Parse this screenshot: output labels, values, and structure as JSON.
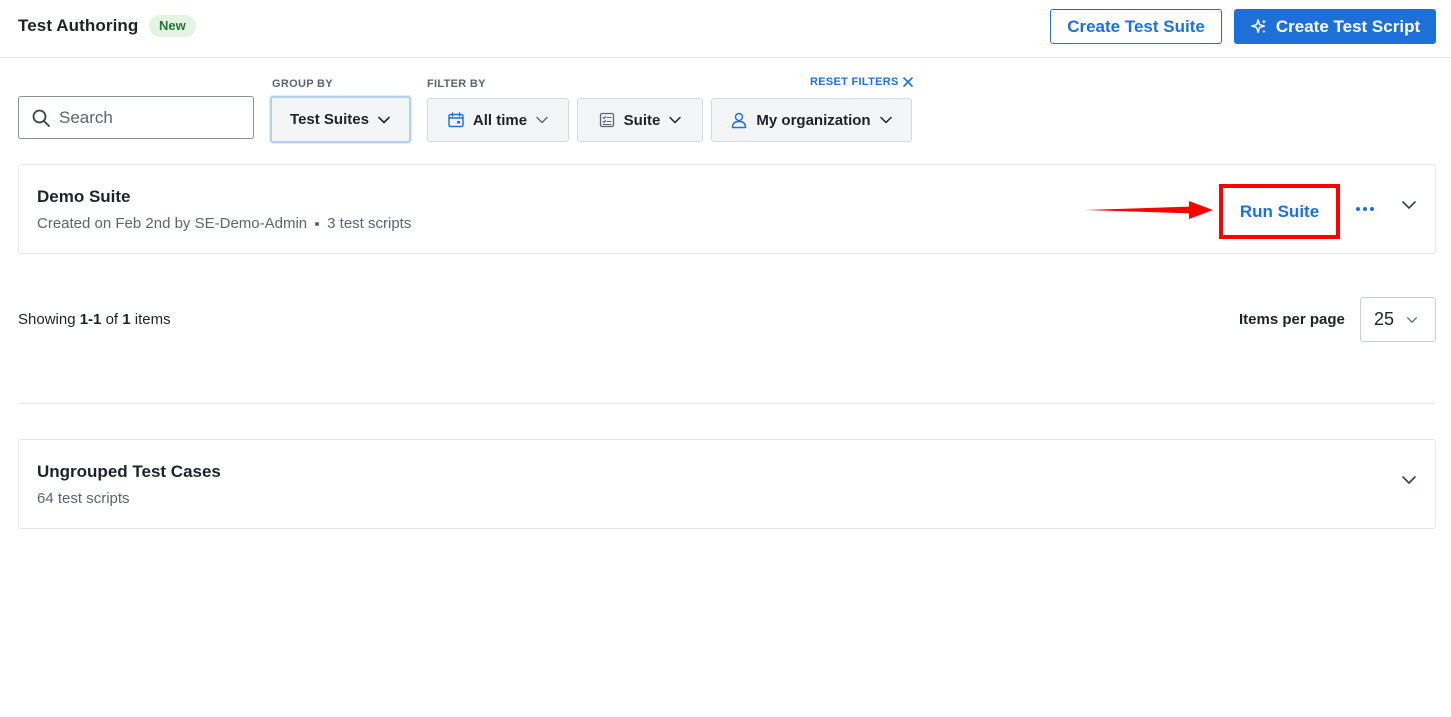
{
  "header": {
    "title": "Test Authoring",
    "badge": "New",
    "create_suite_label": "Create Test Suite",
    "create_script_label": "Create Test Script"
  },
  "filters": {
    "group_by_label": "GROUP BY",
    "filter_by_label": "FILTER BY",
    "reset_label": "RESET FILTERS",
    "search_placeholder": "Search",
    "group_by_value": "Test Suites",
    "time_value": "All time",
    "type_value": "Suite",
    "org_value": "My organization"
  },
  "suites": [
    {
      "title": "Demo Suite",
      "created": "Created on Feb 2nd by SE-Demo-Admin",
      "count": "3 test scripts",
      "run_label": "Run Suite"
    }
  ],
  "pagination": {
    "showing_prefix": "Showing ",
    "range": "1-1",
    "of": " of ",
    "total": "1",
    "suffix": " items",
    "items_per_page_label": "Items per page",
    "items_per_page_value": "25"
  },
  "ungrouped": {
    "title": "Ungrouped Test Cases",
    "count": "64 test scripts"
  },
  "colors": {
    "accent": "#1f6fd8",
    "highlight": "#ff0000",
    "badge_bg": "#e3f4e5",
    "badge_text": "#1d7a33"
  },
  "icons": [
    "search-icon",
    "sparkle-icon",
    "calendar-icon",
    "checklist-icon",
    "user-icon",
    "chevron-down-icon",
    "close-icon",
    "more-icon",
    "arrow-icon"
  ]
}
